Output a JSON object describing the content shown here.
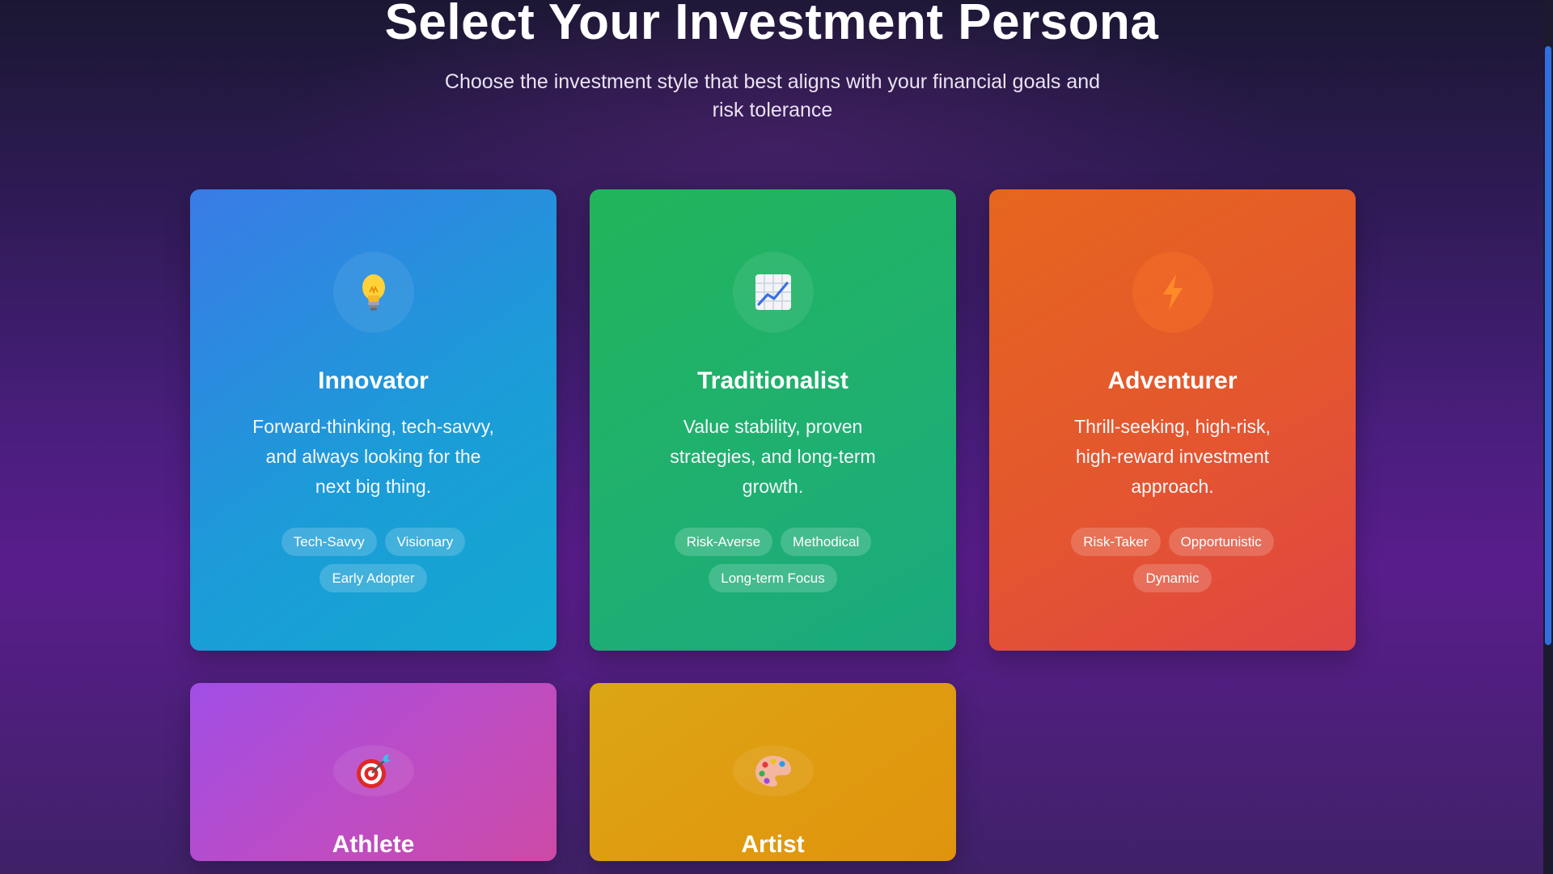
{
  "header": {
    "title": "Select Your Investment Persona",
    "subtitle": "Choose the investment style that best aligns with your financial goals and risk tolerance"
  },
  "personas": [
    {
      "name": "Innovator",
      "icon": "lightbulb-icon",
      "color": "#2a8be0",
      "description": "Forward-thinking, tech-savvy, and always looking for the next big thing.",
      "tags": [
        "Tech-Savvy",
        "Visionary",
        "Early Adopter"
      ]
    },
    {
      "name": "Traditionalist",
      "icon": "chart-increasing-icon",
      "color": "#20b268",
      "description": "Value stability, proven strategies, and long-term growth.",
      "tags": [
        "Risk-Averse",
        "Methodical",
        "Long-term Focus"
      ]
    },
    {
      "name": "Adventurer",
      "icon": "lightning-bolt-icon",
      "color": "#e45a2c",
      "description": "Thrill-seeking, high-risk, high-reward investment approach.",
      "tags": [
        "Risk-Taker",
        "Opportunistic",
        "Dynamic"
      ]
    },
    {
      "name": "Athlete",
      "icon": "target-dart-icon",
      "color": "#b44dd2"
    },
    {
      "name": "Artist",
      "icon": "artist-palette-icon",
      "color": "#de9f12"
    }
  ],
  "scrollbar": {
    "accent": "#2f6fe0"
  }
}
